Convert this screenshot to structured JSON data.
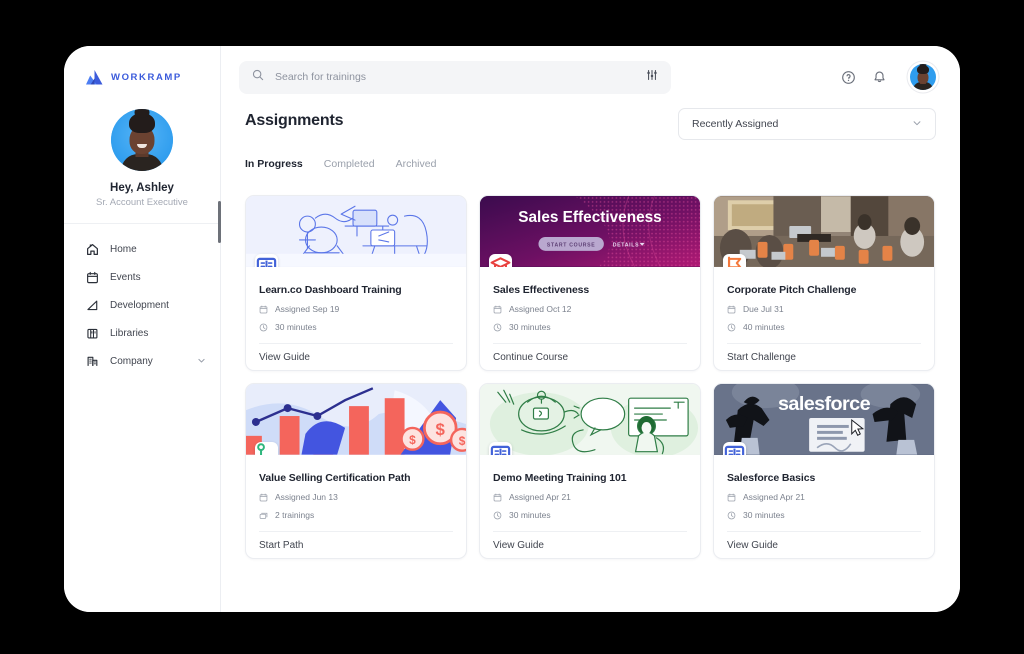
{
  "brand": {
    "name": "WORKRAMP",
    "color": "#3b5bdb",
    "logo_icon": "workramp-triangle-logo"
  },
  "sidebar": {
    "profile": {
      "greeting": "Hey, Ashley",
      "role": "Sr. Account Executive",
      "avatar_icon": "user-avatar"
    },
    "items": [
      {
        "label": "Home",
        "icon": "home-icon",
        "active": true
      },
      {
        "label": "Events",
        "icon": "calendar-icon",
        "active": false
      },
      {
        "label": "Development",
        "icon": "development-ramp-icon",
        "active": false
      },
      {
        "label": "Libraries",
        "icon": "books-library-icon",
        "active": false
      },
      {
        "label": "Company",
        "icon": "company-building-icon",
        "active": false,
        "expandable": true,
        "chevron": "chevron-down-icon"
      }
    ]
  },
  "topbar": {
    "search": {
      "placeholder": "Search for trainings",
      "value": "",
      "icon": "search-icon",
      "filter_icon": "filter-sliders-icon"
    },
    "help_icon": "help-question-circle-icon",
    "notifications_icon": "bell-icon",
    "avatar_icon": "user-avatar-small"
  },
  "main": {
    "title": "Assignments",
    "sort": {
      "value": "Recently Assigned",
      "chevron": "chevron-down-icon"
    },
    "tabs": [
      {
        "label": "In Progress",
        "active": true
      },
      {
        "label": "Completed",
        "active": false
      },
      {
        "label": "Archived",
        "active": false
      }
    ],
    "cards": [
      {
        "title": "Learn.co Dashboard Training",
        "date_label": "Assigned Sep 19",
        "duration_label": "30 minutes",
        "action": "View Guide",
        "badge_icon": "open-book-icon",
        "badge_color": "#4262d8",
        "thumb_style": "illustration-blue-desk",
        "date_icon": "assignment-calendar-icon",
        "duration_icon": "clock-icon"
      },
      {
        "title": "Sales Effectiveness",
        "date_label": "Assigned Oct 12",
        "duration_label": "30 minutes",
        "action": "Continue Course",
        "badge_icon": "graduation-cap-icon",
        "badge_color": "#e8413f",
        "thumb_style": "purple-course-hero",
        "hero_title": "Sales Effectiveness",
        "hero_button": "START COURSE",
        "hero_link": "DETAILS",
        "date_icon": "assignment-calendar-icon",
        "duration_icon": "clock-icon"
      },
      {
        "title": "Corporate Pitch Challenge",
        "date_label": "Due Jul 31",
        "duration_label": "40 minutes",
        "action": "Start Challenge",
        "badge_icon": "challenge-flag-icon",
        "badge_color": "#f4793c",
        "thumb_style": "photo-conference-room",
        "date_icon": "assignment-calendar-icon",
        "duration_icon": "clock-icon"
      },
      {
        "title": "Value Selling Certification Path",
        "date_label": "Assigned Jun 13",
        "duration_label": "2 trainings",
        "action": "Start Path",
        "badge_icon": "path-nodes-icon",
        "badge_color": "#2eb67d",
        "thumb_style": "illustration-chart-money",
        "date_icon": "assignment-calendar-icon",
        "duration_icon": "trainings-stack-icon"
      },
      {
        "title": "Demo Meeting Training 101",
        "date_label": "Assigned Apr 21",
        "duration_label": "30 minutes",
        "action": "View Guide",
        "badge_icon": "open-book-icon",
        "badge_color": "#4262d8",
        "thumb_style": "illustration-green-meeting",
        "date_icon": "assignment-calendar-icon",
        "duration_icon": "clock-icon"
      },
      {
        "title": "Salesforce Basics",
        "date_label": "Assigned Apr 21",
        "duration_label": "30 minutes",
        "action": "View Guide",
        "badge_icon": "open-book-icon",
        "badge_color": "#4262d8",
        "thumb_style": "salesforce-slate",
        "hero_title": "salesforce",
        "date_icon": "assignment-calendar-icon",
        "duration_icon": "clock-icon"
      }
    ]
  }
}
